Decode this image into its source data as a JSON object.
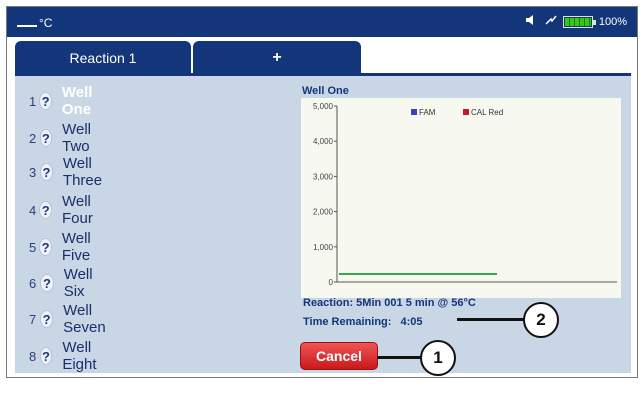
{
  "status_bar": {
    "temperature_unit": "°C",
    "battery_percent": "100%",
    "battery_level": 1.0,
    "icons": [
      "volume-icon",
      "charging-icon",
      "battery-icon"
    ]
  },
  "tabs": [
    {
      "label": "Reaction 1"
    },
    {
      "label": "+"
    }
  ],
  "wells": [
    {
      "num": "1",
      "label": "Well One",
      "status": "?"
    },
    {
      "num": "2",
      "label": "Well Two",
      "status": "?"
    },
    {
      "num": "3",
      "label": "Well Three",
      "status": "?"
    },
    {
      "num": "4",
      "label": "Well Four",
      "status": "?"
    },
    {
      "num": "5",
      "label": "Well Five",
      "status": "?"
    },
    {
      "num": "6",
      "label": "Well Six",
      "status": "?"
    },
    {
      "num": "7",
      "label": "Well Seven",
      "status": "?"
    },
    {
      "num": "8",
      "label": "Well Eight",
      "status": "?"
    }
  ],
  "selected_well_index": 0,
  "chart": {
    "title": "Well One",
    "legend": [
      {
        "name": "FAM",
        "color": "#3b3fc0"
      },
      {
        "name": "CAL Red",
        "color": "#c0202a"
      }
    ],
    "y_ticks": [
      "0",
      "1,000",
      "2,000",
      "3,000",
      "4,000",
      "5,000"
    ],
    "ylim": [
      0,
      5000
    ],
    "line_color": "#3aa64a",
    "colors": {
      "plot_bg": "#f7f8ef",
      "axis": "#555555"
    }
  },
  "reaction_text": "Reaction: 5Min 001 5 min @ 56°C",
  "time_remaining_label": "Time Remaining:",
  "time_remaining_value": "4:05",
  "cancel_label": "Cancel",
  "callouts": [
    {
      "label": "1"
    },
    {
      "label": "2"
    }
  ],
  "colors": {
    "header": "#13357a",
    "panel": "#c8d6e6",
    "cancel": "#d32222"
  }
}
